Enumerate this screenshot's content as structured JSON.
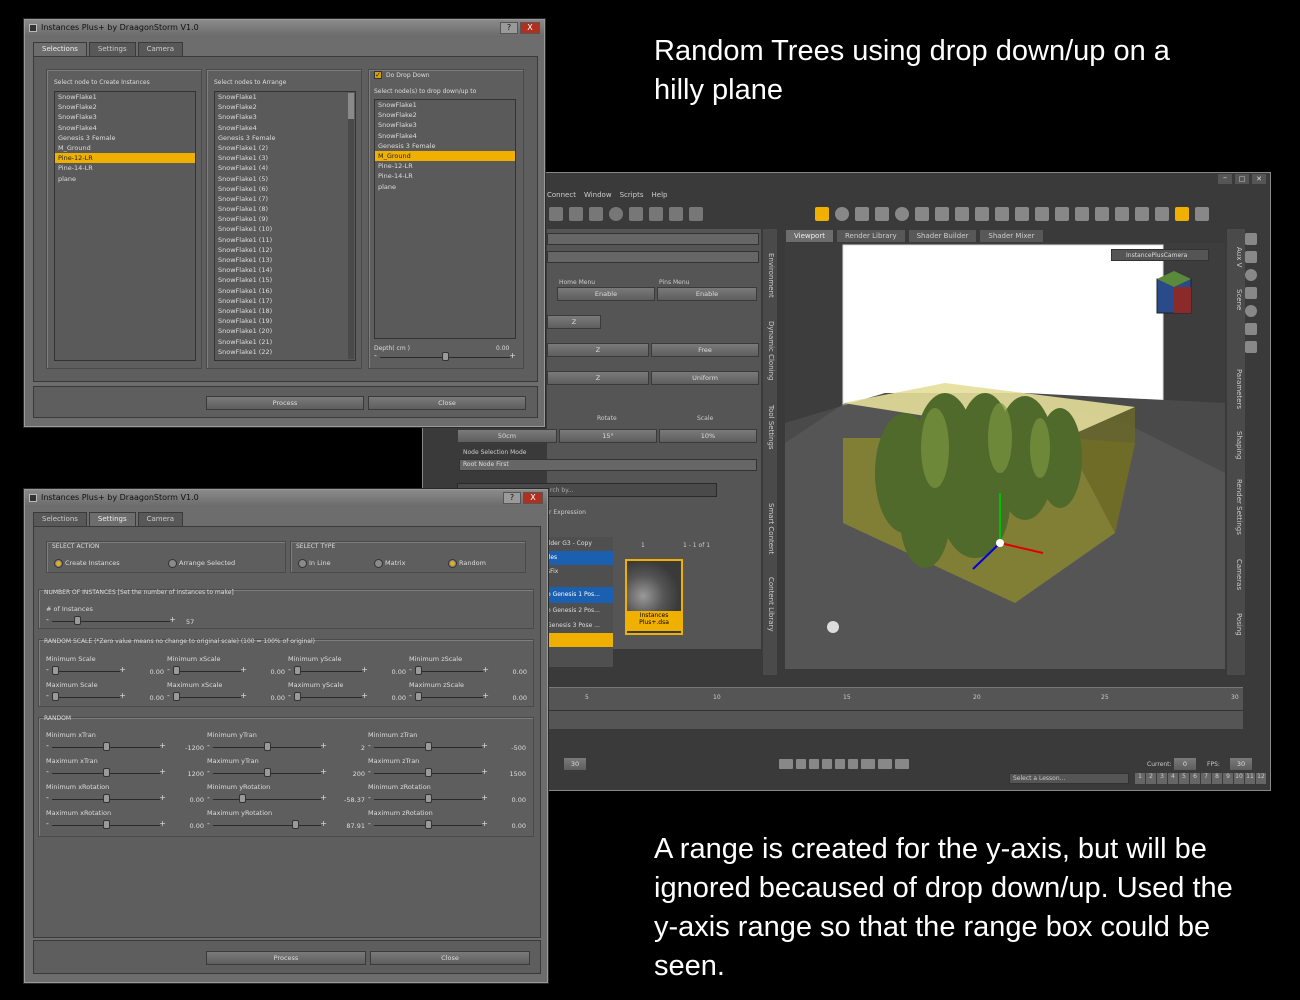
{
  "captions": {
    "top": [
      "Random Trees using drop down/up on a",
      "hilly plane"
    ],
    "bottom": [
      "A range is created for the y-axis, but will be",
      "ignored becaused of drop down/up. Used the",
      "y-axis range so that the range box could be",
      "seen."
    ]
  },
  "dialog1": {
    "title": "Instances Plus+ by DraagonStorm V1.0",
    "help_btn": "?",
    "close_btn": "X",
    "tabs": [
      "Selections",
      "Settings",
      "Camera"
    ],
    "create_label": "Select node to Create Instances",
    "create_items": [
      "SnowFlake1",
      "SnowFlake2",
      "SnowFlake3",
      "SnowFlake4",
      "Genesis 3 Female",
      "M_Ground",
      "Pine-12-LR",
      "Pine-14-LR",
      "plane"
    ],
    "create_selected": "Pine-12-LR",
    "arrange_label": "Select nodes to Arrange",
    "arrange_items": [
      "SnowFlake1",
      "SnowFlake2",
      "SnowFlake3",
      "SnowFlake4",
      "Genesis 3 Female",
      "SnowFlake1 (2)",
      "SnowFlake1 (3)",
      "SnowFlake1 (4)",
      "SnowFlake1 (5)",
      "SnowFlake1 (6)",
      "SnowFlake1 (7)",
      "SnowFlake1 (8)",
      "SnowFlake1 (9)",
      "SnowFlake1 (10)",
      "SnowFlake1 (11)",
      "SnowFlake1 (12)",
      "SnowFlake1 (13)",
      "SnowFlake1 (14)",
      "SnowFlake1 (15)",
      "SnowFlake1 (16)",
      "SnowFlake1 (17)",
      "SnowFlake1 (18)",
      "SnowFlake1 (19)",
      "SnowFlake1 (20)",
      "SnowFlake1 (21)",
      "SnowFlake1 (22)"
    ],
    "drop_checkbox": "Do Drop Down",
    "drop_label": "Select node(s) to drop down/up to",
    "drop_items": [
      "SnowFlake1",
      "SnowFlake2",
      "SnowFlake3",
      "SnowFlake4",
      "Genesis 3 Female",
      "M_Ground",
      "Pine-12-LR",
      "Pine-14-LR",
      "plane"
    ],
    "drop_selected": "M_Ground",
    "depth_label": "Depth( cm )",
    "depth_value": "0.00",
    "depth_level": 0.5,
    "process": "Process",
    "close": "Close"
  },
  "dialog2": {
    "title": "Instances Plus+ by DraagonStorm V1.0",
    "help_btn": "?",
    "close_btn": "X",
    "tabs": [
      "Selections",
      "Settings",
      "Camera"
    ],
    "select_action": {
      "label": "SELECT ACTION",
      "options": [
        "Create Instances",
        "Arrange Selected"
      ],
      "selected": "Create Instances"
    },
    "select_type": {
      "label": "SELECT TYPE",
      "options": [
        "In Line",
        "Matrix",
        "Random"
      ],
      "selected": "Random"
    },
    "instances_group": "NUMBER OF INSTANCES [Set the number of instances to make]",
    "instances_label": "# of Instances",
    "instances_value": "57",
    "random_scale_group": "RANDOM SCALE (*Zero value means no change to original scale) (100 = 100% of original)",
    "scale_fields": [
      {
        "label": "Minimum Scale",
        "value": "0.00"
      },
      {
        "label": "Minimum xScale",
        "value": "0.00"
      },
      {
        "label": "Minimum yScale",
        "value": "0.00"
      },
      {
        "label": "Minimum zScale",
        "value": "0.00"
      },
      {
        "label": "Maximum Scale",
        "value": "0.00"
      },
      {
        "label": "Maximum xScale",
        "value": "0.00"
      },
      {
        "label": "Maximum yScale",
        "value": "0.00"
      },
      {
        "label": "Maximum zScale",
        "value": "0.00"
      }
    ],
    "random_group": "RANDOM",
    "random_fields": [
      {
        "label": "Minimum xTran",
        "value": "-1200"
      },
      {
        "label": "Minimum yTran",
        "value": "2"
      },
      {
        "label": "Minimum zTran",
        "value": "-500"
      },
      {
        "label": "Maximum xTran",
        "value": "1200"
      },
      {
        "label": "Maximum yTran",
        "value": "200"
      },
      {
        "label": "Maximum zTran",
        "value": "1500"
      },
      {
        "label": "Minimum xRotation",
        "value": "0.00"
      },
      {
        "label": "Minimum yRotation",
        "value": "-58.37"
      },
      {
        "label": "Minimum zRotation",
        "value": "0.00"
      },
      {
        "label": "Maximum xRotation",
        "value": "0.00"
      },
      {
        "label": "Maximum yRotation",
        "value": "87.91"
      },
      {
        "label": "Maximum zRotation",
        "value": "0.00"
      }
    ],
    "process": "Process",
    "close": "Close"
  },
  "daz": {
    "menu": [
      "Connect",
      "Window",
      "Scripts",
      "Help"
    ],
    "view_tabs": [
      "Viewport",
      "Render Library",
      "Shader Builder",
      "Shader Mixer"
    ],
    "camera": "InstancePlusCamera",
    "home_menu": "Home Menu",
    "pins_menu": "Pins Menu",
    "enable": "Enable",
    "z": "Z",
    "free": "Free",
    "uniform": "Uniform",
    "transform_headers": [
      "Rotate",
      "Scale"
    ],
    "transform_values": [
      "50cm",
      "15°",
      "10%"
    ],
    "node_mode_label": "Node Selection Mode",
    "node_mode_value": "Root Node First",
    "search": "rch by...",
    "expression": "r Expression",
    "page": "1",
    "page_range": "1 - 1 of 1",
    "content_rows": [
      "ilder G3 - Copy",
      "iles",
      "sFix",
      "o Genesis 1 Pos...",
      "o Genesis 2 Pos...",
      "Genesis 3 Pose ..."
    ],
    "script_item": "Instances Plus+.dsa",
    "side_tabs": [
      "Environment",
      "Dynamic Cloning",
      "Tool Settings",
      "Smart Content",
      "Content Library"
    ],
    "right_tabs": [
      "Aux V",
      "Scene",
      "Parameters",
      "Shaping",
      "Render Settings",
      "Cameras",
      "Posing"
    ],
    "timeline_ticks": [
      "5",
      "10",
      "15",
      "20",
      "25",
      "30"
    ],
    "end_frame": "30",
    "current_label": "Current:",
    "current_value": "0",
    "fps_label": "FPS:",
    "fps_value": "30",
    "lesson": "Select a Lesson...",
    "lesson_steps": [
      "1",
      "2",
      "3",
      "4",
      "5",
      "6",
      "7",
      "8",
      "9",
      "10",
      "11",
      "12"
    ]
  },
  "colors": {
    "accent": "#f0b000",
    "selection_blue": "#1b5fb0"
  }
}
